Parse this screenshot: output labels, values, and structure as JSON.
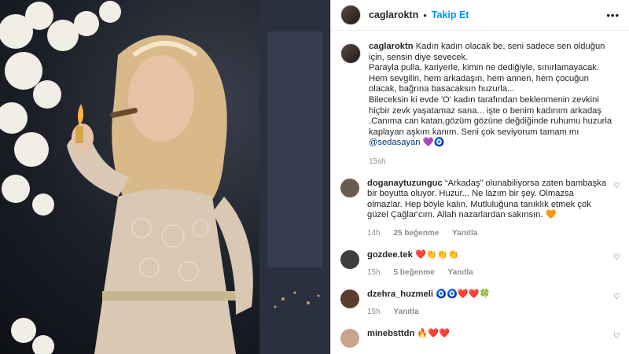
{
  "post": {
    "username": "caglaroktn",
    "follow_label": "Takip Et",
    "separator": "•",
    "more_label": "•••",
    "caption_lines": [
      "Kadın kadın olacak be, seni sadece sen olduğun",
      "için, sensin diye sevecek.",
      "Parayla pulla, kariyerle, kimin ne dediğiyle, sınırlamayacak.",
      "Hem sevgilin, hem arkadaşın, hem annen, hem çocuğun",
      "olacak, bağrına basacaksın huzurla...",
      "Bileceksin ki evde 'O' kadın tarafından beklenmenin zevkini",
      "hiçbir zevk yaşatamaz sana... işte o benim kadınım arkadaş",
      ".Canıma can katan,gözüm gözüne değdiğinde ruhumu huzurla",
      "kaplayan aşkım kanım. Seni çok seviyorum tamam mı"
    ],
    "mention": "@sedasayan",
    "mention_emoji": "💜🧿",
    "time": "15sh"
  },
  "comments": [
    {
      "username": "doganaytuzunguc",
      "lines": [
        "“Arkadaş” olunabiliyorsa zaten bambaşka",
        "bir boyutta oluyor. Huzur... Ne lazım bir şey. Olmazsa",
        "olmazlar. Hep böyle kalın. Mutluluğuna tanıklık etmek çok",
        "güzel Çağlar'cım. Allah nazarlardan sakınsın. 🧡"
      ],
      "time": "14h",
      "likes": "25 beğenme",
      "reply": "Yanıtla",
      "avatar_color": "#6b5a4e"
    },
    {
      "username": "gozdee.tek",
      "lines": [
        "❤️👏👏👏"
      ],
      "time": "15h",
      "likes": "5 beğenme",
      "reply": "Yanıtla",
      "avatar_color": "#3d3d3d"
    },
    {
      "username": "dzehra_huzmeli",
      "lines": [
        "🧿🧿❤️❤️🍀"
      ],
      "time": "15h",
      "likes": "",
      "reply": "Yanıtla",
      "avatar_color": "#5a3d2e"
    },
    {
      "username": "minebsttdn",
      "lines": [
        "🔥❤️❤️"
      ],
      "time": "",
      "likes": "",
      "reply": "",
      "avatar_color": "#c9a38a"
    }
  ],
  "icons": {
    "heart": "heart-outline-icon"
  },
  "colors": {
    "link": "#0095f6",
    "mention": "#00376b",
    "muted": "#8e8e8e"
  }
}
